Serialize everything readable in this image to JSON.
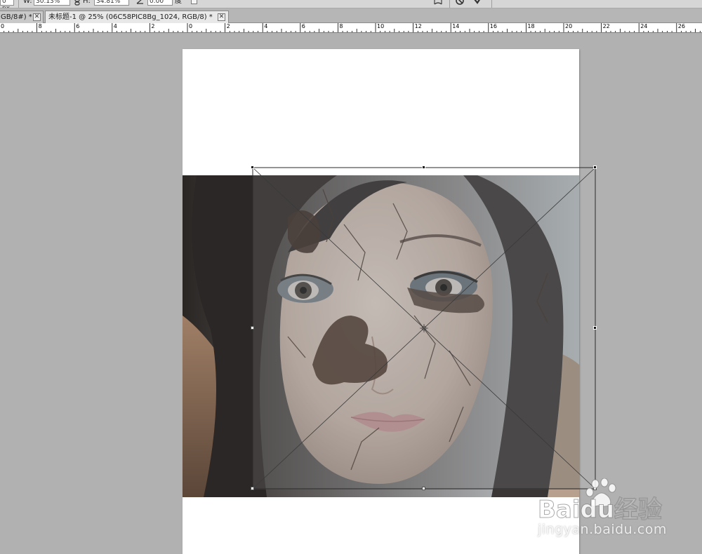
{
  "options_bar": {
    "x_value": "0 px",
    "w_label": "W:",
    "w_value": "30.13%",
    "h_label": "H:",
    "h_value": "34.81%",
    "angle_value": "0.00",
    "angle_unit": "度"
  },
  "tabs": [
    {
      "label": "GB/8#) *",
      "active": false
    },
    {
      "label": "未标题-1 @ 25% (06C58PIC8Bg_1024, RGB/8) *",
      "active": true
    }
  ],
  "ruler": {
    "labels": [
      "0",
      "8",
      "6",
      "4",
      "2",
      "0",
      "2",
      "4",
      "6",
      "8",
      "10",
      "12",
      "14",
      "16",
      "18",
      "20",
      "22",
      "24",
      "26"
    ]
  },
  "watermark": {
    "brand": "Baidu经验",
    "url": "jingyan.baidu.com"
  },
  "icons": {
    "close": "close-icon",
    "link": "link-icon",
    "angle": "angle-icon",
    "warp": "warp-icon",
    "cancel": "cancel-icon",
    "commit": "commit-icon",
    "paw": "baidu-paw-icon"
  }
}
